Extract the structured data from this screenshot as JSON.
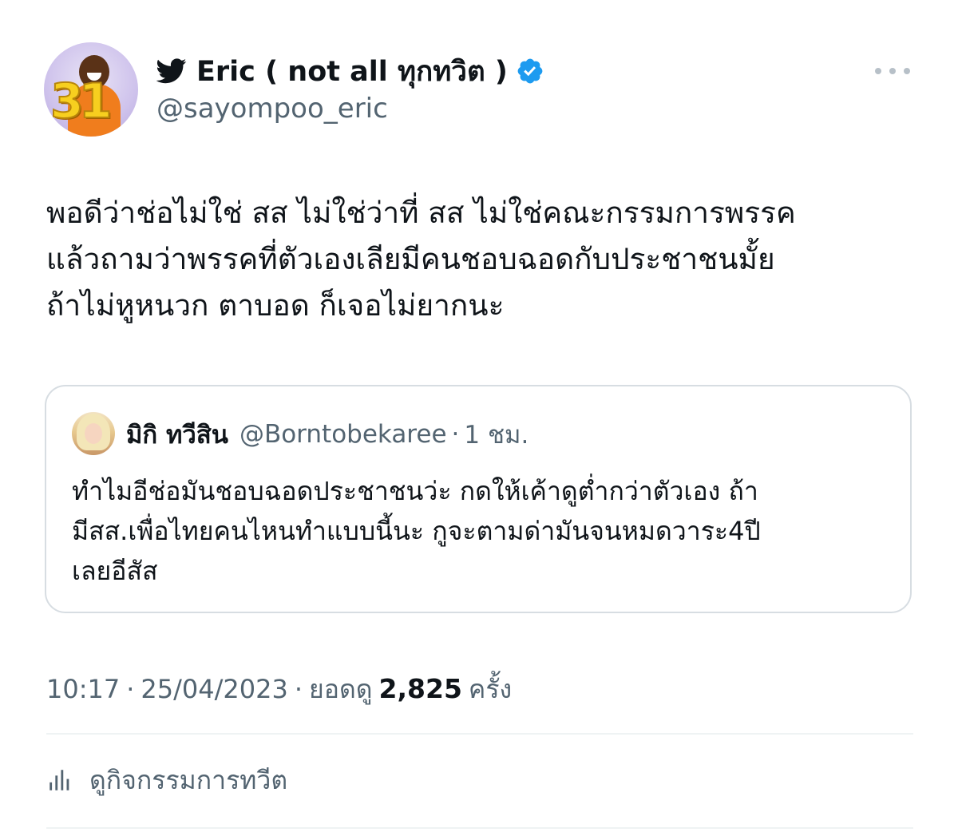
{
  "author": {
    "display_name": "Eric ( not all ทุกทวิต )",
    "handle": "@sayompoo_eric",
    "avatar_number": "31",
    "verified": true
  },
  "tweet": {
    "text_lines": [
      "พอดีว่าช่อไม่ใช่ สส ไม่ใช่ว่าที่ สส ไม่ใช่คณะกรรมการพรรค",
      "แล้วถามว่าพรรคที่ตัวเองเลียมีคนชอบฉอดกับประชาชนมั้ย",
      "ถ้าไม่หูหนวก ตาบอด ก็เจอไม่ยากนะ"
    ]
  },
  "quote": {
    "name": "มิกิ ทวีสิน",
    "handle": "@Borntobekaree",
    "separator": "·",
    "time": "1 ชม.",
    "text_lines": [
      "ทำไมอีช่อมันชอบฉอดประชาชนว่ะ กดให้เค้าดูต่ำกว่าตัวเอง ถ้า",
      "มีสส.เพื่อไทยคนไหนทำแบบนี้นะ กูจะตามด่ามันจนหมดวาระ4ปี",
      "เลยอีสัส"
    ]
  },
  "meta": {
    "time": "10:17",
    "sep": "·",
    "date": "25/04/2023",
    "views_label": "ยอดดู",
    "views_count": "2,825",
    "views_suffix": "ครั้ง"
  },
  "actions": {
    "activity_label": "ดูกิจกรรมการทวีต"
  },
  "colors": {
    "text_primary": "#0f1419",
    "text_secondary": "#536471",
    "verified_blue": "#1d9bf0",
    "border": "#d7dde2"
  }
}
